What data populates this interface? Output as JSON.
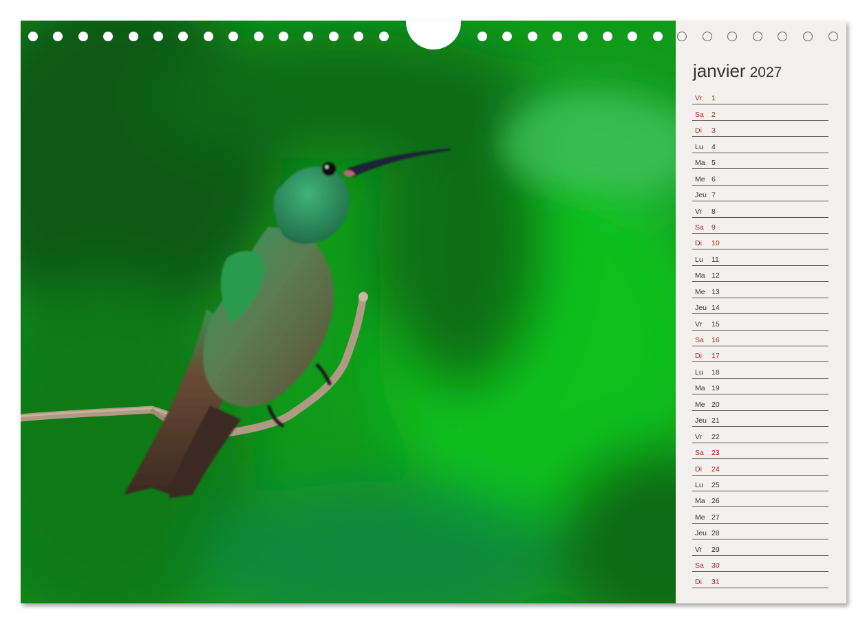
{
  "calendar": {
    "month": "janvier",
    "year": "2027",
    "colors": {
      "weekend": "#b51f1f",
      "weekday": "#333333",
      "paper": "#f2f1ed"
    },
    "days": [
      {
        "name": "Vr",
        "num": "1",
        "weekend": true
      },
      {
        "name": "Sa",
        "num": "2",
        "weekend": true
      },
      {
        "name": "Di",
        "num": "3",
        "weekend": true
      },
      {
        "name": "Lu",
        "num": "4",
        "weekend": false
      },
      {
        "name": "Ma",
        "num": "5",
        "weekend": false
      },
      {
        "name": "Me",
        "num": "6",
        "weekend": false
      },
      {
        "name": "Jeu",
        "num": "7",
        "weekend": false
      },
      {
        "name": "Vr",
        "num": "8",
        "weekend": false
      },
      {
        "name": "Sa",
        "num": "9",
        "weekend": true
      },
      {
        "name": "Di",
        "num": "10",
        "weekend": true
      },
      {
        "name": "Lu",
        "num": "11",
        "weekend": false
      },
      {
        "name": "Ma",
        "num": "12",
        "weekend": false
      },
      {
        "name": "Me",
        "num": "13",
        "weekend": false
      },
      {
        "name": "Jeu",
        "num": "14",
        "weekend": false
      },
      {
        "name": "Vr",
        "num": "15",
        "weekend": false
      },
      {
        "name": "Sa",
        "num": "16",
        "weekend": true
      },
      {
        "name": "Di",
        "num": "17",
        "weekend": true
      },
      {
        "name": "Lu",
        "num": "18",
        "weekend": false
      },
      {
        "name": "Ma",
        "num": "19",
        "weekend": false
      },
      {
        "name": "Me",
        "num": "20",
        "weekend": false
      },
      {
        "name": "Jeu",
        "num": "21",
        "weekend": false
      },
      {
        "name": "Vr",
        "num": "22",
        "weekend": false
      },
      {
        "name": "Sa",
        "num": "23",
        "weekend": true
      },
      {
        "name": "Di",
        "num": "24",
        "weekend": true
      },
      {
        "name": "Lu",
        "num": "25",
        "weekend": false
      },
      {
        "name": "Ma",
        "num": "26",
        "weekend": false
      },
      {
        "name": "Me",
        "num": "27",
        "weekend": false
      },
      {
        "name": "Jeu",
        "num": "28",
        "weekend": false
      },
      {
        "name": "Vr",
        "num": "29",
        "weekend": false
      },
      {
        "name": "Sa",
        "num": "30",
        "weekend": true
      },
      {
        "name": "Di",
        "num": "31",
        "weekend": true
      }
    ]
  },
  "binding": {
    "filled_holes": 29,
    "ring_holes": 7,
    "has_hanger": true
  },
  "photo": {
    "subject": "hummingbird-on-branch",
    "palette": {
      "background": "#13a51c",
      "bird_body": "#4c6a3c",
      "bird_head": "#2a8f5a",
      "branch": "#b7a189"
    }
  }
}
